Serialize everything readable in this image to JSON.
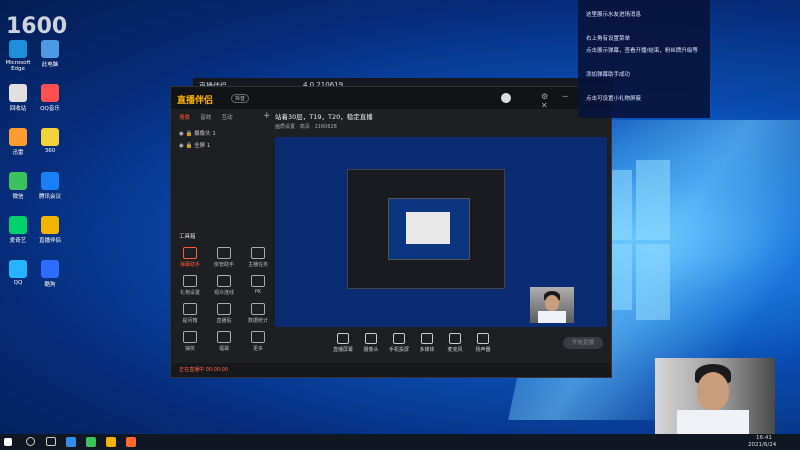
{
  "desktop": {
    "icons": [
      {
        "label": "Microsoft Edge",
        "color": "#1f8ed8"
      },
      {
        "label": "此电脑",
        "color": "#4d9be3"
      },
      {
        "label": "回收站",
        "color": "#e0e0e0"
      },
      {
        "label": "QQ音乐",
        "color": "#ff4f4f"
      },
      {
        "label": "迅雷",
        "color": "#ff9b2f"
      },
      {
        "label": "360",
        "color": "#f2d33a"
      },
      {
        "label": "微信",
        "color": "#39c35a"
      },
      {
        "label": "腾讯会议",
        "color": "#1780f5"
      },
      {
        "label": "爱奇艺",
        "color": "#00d26b"
      },
      {
        "label": "直播伴侣",
        "color": "#f2b400"
      },
      {
        "label": "QQ",
        "color": "#25b3ff"
      },
      {
        "label": "酷狗",
        "color": "#2e6cff"
      }
    ],
    "overlay_text": "1600"
  },
  "app": {
    "back_title": "直播伴侣",
    "version": "4.0.210619",
    "logo": "直播伴侣",
    "badge": "抖音",
    "tabs": [
      "场景",
      "音效",
      "互动"
    ],
    "scenes": [
      "摄像头 1",
      "全屏 1"
    ],
    "tools_header": "工具箱",
    "tools": [
      "弹幕助手",
      "房管助手",
      "主播任务",
      "礼物设置",
      "观众连线",
      "PK",
      "提问箱",
      "直播贴",
      "数据统计",
      "抽奖",
      "福袋",
      "更多"
    ],
    "preview_title": "站着30层，T19，T20，稳定直播",
    "quality": "高清",
    "preview_meta": [
      "画质设置",
      "高清",
      "2160628"
    ],
    "bottom": [
      "直播屏幕",
      "摄像头",
      "手机投屏",
      "多媒体",
      "麦克风",
      "扬声器"
    ],
    "go_live": "开始直播",
    "status": "正在直播中 00:00:00"
  },
  "notification": {
    "lines": [
      "这里展示水友进场消息",
      "",
      "右上角有设置菜单",
      "点击展示弹幕，查看开播/结束，粉丝牌升级等",
      "",
      "添加弹幕助手成功",
      "",
      "点击可设置小礼物屏蔽"
    ]
  },
  "taskbar": {
    "time": "16:41",
    "date": "2021/6/24"
  }
}
